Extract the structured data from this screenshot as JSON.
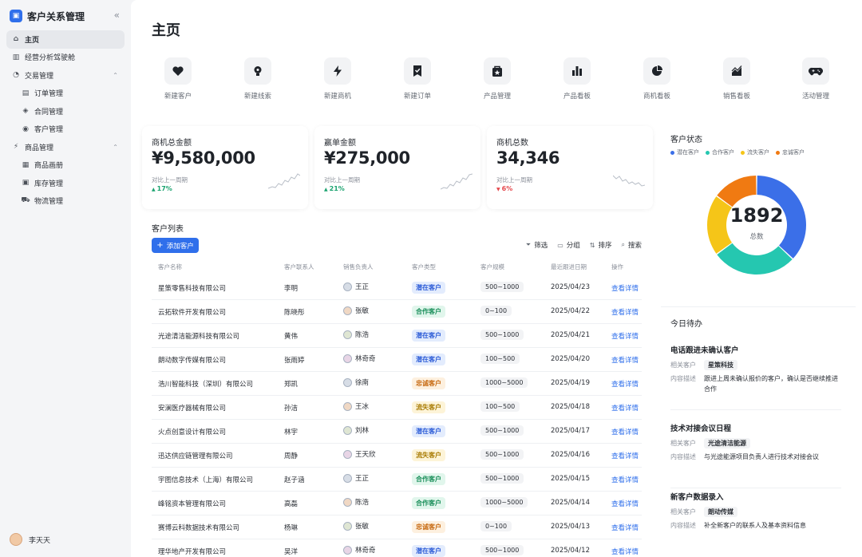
{
  "sidebar": {
    "brand": "客户关系管理",
    "items": [
      {
        "label": "主页",
        "icon": "home-icon",
        "level": 0,
        "active": true
      },
      {
        "label": "经营分析驾驶舱",
        "icon": "bar-chart-icon",
        "level": 0
      },
      {
        "label": "交易管理",
        "icon": "transaction-icon",
        "level": 0,
        "expandable": true
      },
      {
        "label": "订单管理",
        "icon": "order-icon",
        "level": 1
      },
      {
        "label": "合同管理",
        "icon": "contract-icon",
        "level": 1
      },
      {
        "label": "客户管理",
        "icon": "customer-icon",
        "level": 1
      },
      {
        "label": "商品管理",
        "icon": "product-icon",
        "level": 0,
        "expandable": true
      },
      {
        "label": "商品画册",
        "icon": "catalog-icon",
        "level": 1
      },
      {
        "label": "库存管理",
        "icon": "inventory-icon",
        "level": 1
      },
      {
        "label": "物流管理",
        "icon": "logistics-icon",
        "level": 1
      }
    ],
    "user": "李天天"
  },
  "main": {
    "title": "主页",
    "quick_actions": [
      {
        "label": "新建客户",
        "icon": "heart-icon"
      },
      {
        "label": "新建线索",
        "icon": "lightbulb-icon"
      },
      {
        "label": "新建商机",
        "icon": "lightning-icon"
      },
      {
        "label": "新建订单",
        "icon": "check-badge-icon"
      },
      {
        "label": "产品管理",
        "icon": "star-bag-icon"
      },
      {
        "label": "产品看板",
        "icon": "bar-chart-icon"
      },
      {
        "label": "商机看板",
        "icon": "pie-chart-icon"
      },
      {
        "label": "销售看板",
        "icon": "trend-chart-icon"
      },
      {
        "label": "活动管理",
        "icon": "gamepad-icon"
      }
    ],
    "stats": [
      {
        "label": "商机总金额",
        "value": "¥9,580,000",
        "compare": "对比上一周期",
        "delta": "17%",
        "trend": "up",
        "color": "#1aa36f"
      },
      {
        "label": "赢单金额",
        "value": "¥275,000",
        "compare": "对比上一周期",
        "delta": "21%",
        "trend": "up",
        "color": "#1aa36f"
      },
      {
        "label": "商机总数",
        "value": "34,346",
        "compare": "对比上一周期",
        "delta": "6%",
        "trend": "down",
        "color": "#e5484d"
      }
    ],
    "customer_list": {
      "title": "客户列表",
      "add_button": "添加客户",
      "tools": [
        {
          "label": "筛选",
          "icon": "filter-icon"
        },
        {
          "label": "分组",
          "icon": "group-icon"
        },
        {
          "label": "排序",
          "icon": "sort-icon"
        },
        {
          "label": "搜索",
          "icon": "search-icon"
        }
      ],
      "columns": [
        "客户名称",
        "客户联系人",
        "销售负责人",
        "客户类型",
        "客户规模",
        "最近跟进日期",
        "操作"
      ],
      "rows": [
        {
          "name": "星策零售科技有限公司",
          "contact": "李明",
          "owner": "王正",
          "type": "潜在客户",
          "type_color": "blue",
          "scale": "500~1000",
          "date": "2025/04/23",
          "action": "查看详情"
        },
        {
          "name": "云拓软件开发有限公司",
          "contact": "陈晓彤",
          "owner": "张敏",
          "type": "合作客户",
          "type_color": "green",
          "scale": "0~100",
          "date": "2025/04/22",
          "action": "查看详情"
        },
        {
          "name": "光途清洁能源科技有限公司",
          "contact": "黄伟",
          "owner": "陈浩",
          "type": "潜在客户",
          "type_color": "blue",
          "scale": "500~1000",
          "date": "2025/04/21",
          "action": "查看详情"
        },
        {
          "name": "朗动数字传媒有限公司",
          "contact": "张雨婷",
          "owner": "林奇奇",
          "type": "潜在客户",
          "type_color": "blue",
          "scale": "100~500",
          "date": "2025/04/20",
          "action": "查看详情"
        },
        {
          "name": "浩川智能科技（深圳）有限公司",
          "contact": "郑凯",
          "owner": "徐南",
          "type": "忠诚客户",
          "type_color": "orange",
          "scale": "1000~5000",
          "date": "2025/04/19",
          "action": "查看详情"
        },
        {
          "name": "安澜医疗器械有限公司",
          "contact": "孙洁",
          "owner": "王冰",
          "type": "流失客户",
          "type_color": "yellow",
          "scale": "100~500",
          "date": "2025/04/18",
          "action": "查看详情"
        },
        {
          "name": "火点创意设计有限公司",
          "contact": "林宇",
          "owner": "刘林",
          "type": "潜在客户",
          "type_color": "blue",
          "scale": "500~1000",
          "date": "2025/04/17",
          "action": "查看详情"
        },
        {
          "name": "迅达供应链管理有限公司",
          "contact": "周静",
          "owner": "王天欣",
          "type": "流失客户",
          "type_color": "yellow",
          "scale": "500~1000",
          "date": "2025/04/16",
          "action": "查看详情"
        },
        {
          "name": "宇图信息技术（上海）有限公司",
          "contact": "赵子涵",
          "owner": "王正",
          "type": "合作客户",
          "type_color": "green",
          "scale": "500~1000",
          "date": "2025/04/15",
          "action": "查看详情"
        },
        {
          "name": "峰铭资本管理有限公司",
          "contact": "高磊",
          "owner": "陈浩",
          "type": "合作客户",
          "type_color": "green",
          "scale": "1000~5000",
          "date": "2025/04/14",
          "action": "查看详情"
        },
        {
          "name": "赛博云科数据技术有限公司",
          "contact": "杨琳",
          "owner": "张敏",
          "type": "忠诚客户",
          "type_color": "orange",
          "scale": "0~100",
          "date": "2025/04/13",
          "action": "查看详情"
        },
        {
          "name": "理华地产开发有限公司",
          "contact": "吴洋",
          "owner": "林奇奇",
          "type": "潜在客户",
          "type_color": "blue",
          "scale": "500~1000",
          "date": "2025/04/12",
          "action": "查看详情"
        }
      ]
    },
    "customer_status": {
      "title": "客户状态",
      "legend": [
        {
          "label": "潜在客户",
          "color": "#3b6fe8"
        },
        {
          "label": "合作客户",
          "color": "#25c7b0"
        },
        {
          "label": "流失客户",
          "color": "#f5c518"
        },
        {
          "label": "忠诚客户",
          "color": "#f07a12"
        }
      ],
      "total": "1892",
      "total_label": "总数"
    },
    "todo": {
      "title": "今日待办",
      "tasks": [
        {
          "title": "电话跟进未确认客户",
          "customer_key": "相关客户",
          "customer": "星策科技",
          "desc_key": "内容描述",
          "desc": "跟进上周未确认报价的客户，确认是否继续推进合作"
        },
        {
          "title": "技术对接会议日程",
          "customer_key": "相关客户",
          "customer": "光途清洁能源",
          "desc_key": "内容描述",
          "desc": "与光途能源项目负责人进行技术对接会议"
        },
        {
          "title": "新客户数据录入",
          "customer_key": "相关客户",
          "customer": "朗动传媒",
          "desc_key": "内容描述",
          "desc": "补全新客户的联系人及基本资料信息"
        }
      ]
    }
  },
  "chart_data": {
    "type": "pie",
    "categories": [
      "潜在客户",
      "合作客户",
      "流失客户",
      "忠诚客户"
    ],
    "values": [
      0.37,
      0.28,
      0.2,
      0.15
    ]
  }
}
